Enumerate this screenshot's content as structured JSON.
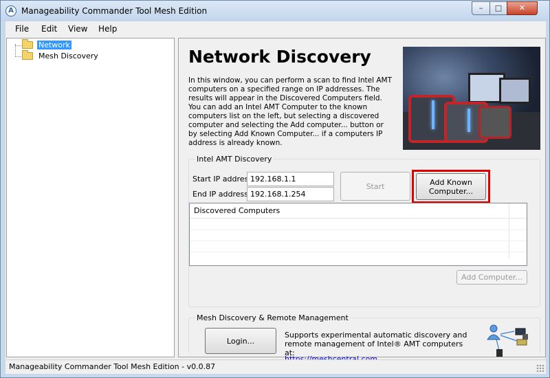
{
  "window": {
    "title": "Manageability Commander Tool Mesh Edition",
    "app_icon": "A",
    "controls": {
      "minimize": "–",
      "maximize": "□",
      "close": "✕"
    }
  },
  "menu": [
    {
      "label": "File"
    },
    {
      "label": "Edit"
    },
    {
      "label": "View"
    },
    {
      "label": "Help"
    }
  ],
  "tree": {
    "items": [
      {
        "label": "Network",
        "selected": true,
        "icon": "folder-icon"
      },
      {
        "label": "Mesh Discovery",
        "selected": false,
        "icon": "folder-icon"
      }
    ]
  },
  "main": {
    "heading": "Network Discovery",
    "intro": "In this window, you can perform a scan to find Intel AMT computers on a specified range on IP addresses. The results will appear in the Discovered Computers field. You can add an Intel AMT Computer to the known computers list on the left, but selecting a discovered computer and selecting the Add computer... button or by selecting Add Known Computer... if a computers IP address is already known.",
    "discovery": {
      "group_title": "Intel AMT Discovery",
      "start_label": "Start IP address",
      "start_value": "192.168.1.1",
      "end_label": "End IP address",
      "end_value": "192.168.1.254",
      "start_button": "Start",
      "add_known_button": "Add Known Computer...",
      "list_header": "Discovered Computers",
      "add_computer_button": "Add Computer..."
    },
    "mesh": {
      "group_title": "Mesh Discovery & Remote Management",
      "login_button": "Login...",
      "description": "Supports experimental automatic discovery and remote management of Intel® AMT computers at:",
      "link": "https://meshcentral.com"
    }
  },
  "status": {
    "text": "Manageability Commander Tool Mesh Edition - v0.0.87"
  },
  "colors": {
    "selection": "#3399ff",
    "highlight": "#e00000",
    "link": "#0000ee"
  }
}
